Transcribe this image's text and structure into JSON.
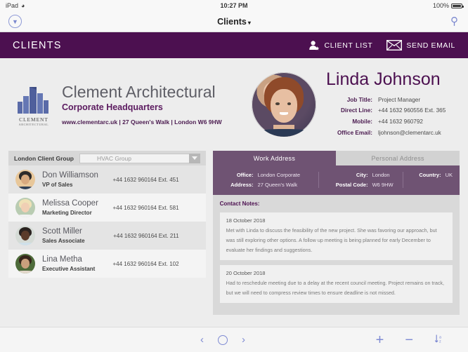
{
  "statusbar": {
    "device": "iPad",
    "wifi_icon": "wifi-icon",
    "time": "10:27 PM",
    "battery_percent": "100%"
  },
  "navbar": {
    "back_icon": "chevron-down-circle-icon",
    "title": "Clients",
    "caret": "▾",
    "search_icon": "search-icon"
  },
  "appheader": {
    "title": "CLIENTS",
    "client_list_label": "CLIENT LIST",
    "client_list_icon": "person-star-icon",
    "send_email_label": "SEND EMAIL",
    "send_email_icon": "envelope-icon",
    "accent_color": "#4c1050"
  },
  "company": {
    "logo_icon": "building-logo-icon",
    "logo_name": "CLEMENT",
    "logo_sub": "ARCHITECTURAL",
    "name": "Clement Architectural",
    "subtitle": "Corporate Headquarters",
    "meta": "www.clementarc.uk | 27 Queen's Walk | London W6 9HW"
  },
  "person": {
    "photo_icon": "contact-photo",
    "name": "Linda Johnson",
    "fields": [
      {
        "label": "Job Title:",
        "value": "Project Manager"
      },
      {
        "label": "Direct Line:",
        "value": "+44 1632 960556  Ext. 365"
      },
      {
        "label": "Mobile:",
        "value": "+44 1632 960792"
      },
      {
        "label": "Office Email:",
        "value": "ljohnson@clementarc.uk"
      }
    ]
  },
  "client_group": {
    "label": "London Client Group",
    "selected": "HVAC Group",
    "dropdown_icon": "chevron-down-icon"
  },
  "clients": [
    {
      "name": "Don Williamson",
      "title": "VP of Sales",
      "phone": "+44 1632 960164  Ext. 451",
      "avatar_icon": "avatar-don-williamson"
    },
    {
      "name": "Melissa Cooper",
      "title": "Marketing Director",
      "phone": "+44 1632 960164  Ext. 581",
      "avatar_icon": "avatar-melissa-cooper"
    },
    {
      "name": "Scott Miller",
      "title": "Sales Associate",
      "phone": "+44 1632 960164  Ext. 211",
      "avatar_icon": "avatar-scott-miller"
    },
    {
      "name": "Lina Metha",
      "title": "Executive Assistant",
      "phone": "+44 1632 960164  Ext. 102",
      "avatar_icon": "avatar-lina-metha"
    }
  ],
  "address": {
    "tabs": [
      {
        "label": "Work Address",
        "active": true
      },
      {
        "label": "Personal Address",
        "active": false
      }
    ],
    "panel_color": "#6f5373",
    "col1": [
      {
        "label": "Office:",
        "value": "London Corporate"
      },
      {
        "label": "Address:",
        "value": "27 Queen's Walk"
      }
    ],
    "col2": [
      {
        "label": "City:",
        "value": "London"
      },
      {
        "label": "Postal Code:",
        "value": "W6 9HW"
      }
    ],
    "col3": [
      {
        "label": "Country:",
        "value": "UK"
      }
    ]
  },
  "notes": {
    "title": "Contact Notes:",
    "items": [
      {
        "date": "18 October 2018",
        "body": "Met with Linda to discuss the feasibility of the new project. She was favoring our approach, but was still exploring other options. A follow up meeting is being planned for early December to evaluate her findings and suggestions."
      },
      {
        "date": "20 October 2018",
        "body": "Had to reschedule meeting due to a delay at the recent council meeting. Project remains on track, but we will need to compress review times to ensure deadline is not missed."
      }
    ]
  },
  "toolbar": {
    "prev_icon": "chevron-left-icon",
    "home_icon": "circle-icon",
    "next_icon": "chevron-right-icon",
    "add_icon": "plus-icon",
    "remove_icon": "minus-icon",
    "sort_icon": "sort-az-icon"
  }
}
